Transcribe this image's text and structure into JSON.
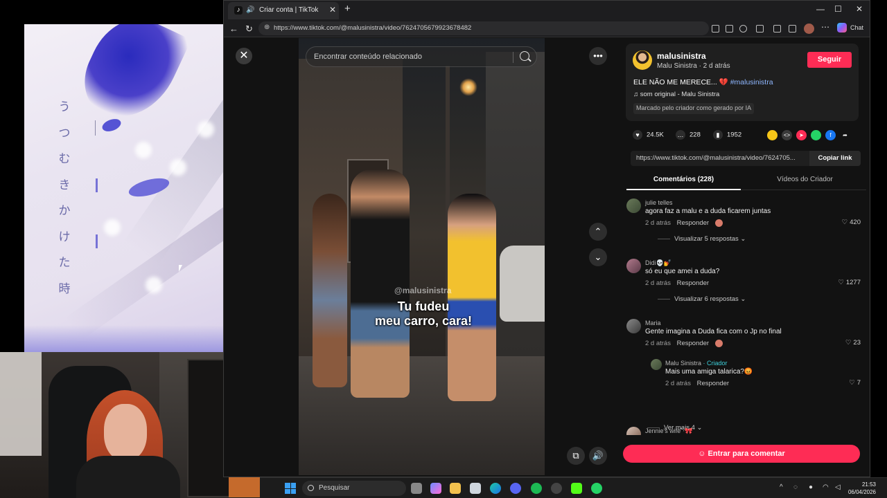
{
  "art": {
    "vertical_text": [
      "う",
      "つ",
      "む",
      "き",
      "か",
      "け",
      "た",
      "時"
    ]
  },
  "browser": {
    "tab_title": "Criar conta | TikTok",
    "url": "https://www.tiktok.com/@malusinistra/video/7624705679923678482",
    "chat_label": "Chat"
  },
  "video": {
    "search_placeholder": "Encontrar conteúdo relacionado",
    "watermark": "@malusinistra",
    "caption_line1": "Tu fudeu",
    "caption_line2": "meu carro, cara!"
  },
  "post": {
    "username": "malusinistra",
    "meta": "Malu Sinistra · 2 d atrás",
    "follow_label": "Seguir",
    "description": "ELE NÃO ME MERECE... 💔",
    "hashtag": "#malusinistra",
    "music": "som original - Malu Sinistra",
    "ai_label": "Marcado pelo criador como gerado por IA",
    "likes": "24.5K",
    "comments": "228",
    "saves": "1952",
    "share_url": "https://www.tiktok.com/@malusinistra/video/7624705...",
    "copy_label": "Copiar link"
  },
  "tabs": {
    "comments": "Comentários (228)",
    "creator_videos": "Vídeos do Criador"
  },
  "comments": [
    {
      "user": "julie telles",
      "text": "agora faz a malu e a duda ficarem juntas",
      "time": "2 d atrás",
      "reply": "Responder",
      "likes": "420",
      "view_replies": "Visualizar 5 respostas ⌄"
    },
    {
      "user": "Didi💀💅",
      "text": "só eu que amei a duda?",
      "time": "2 d atrás",
      "reply": "Responder",
      "likes": "1277",
      "view_replies": "Visualizar 6 respostas ⌄"
    },
    {
      "user": "Maria",
      "text": "Gente imagina a Duda fica com o Jp no final",
      "time": "2 d atrás",
      "reply": "Responder",
      "likes": "23"
    },
    {
      "user": "Malu Sinistra",
      "creator_tag": "· Criador",
      "text": "Mais uma amiga talarica?😡",
      "time": "2 d atrás",
      "reply": "Responder",
      "likes": "7",
      "view_more": "Ver mais 4 ⌄"
    },
    {
      "user": "Jennie's wife˚‧🎀"
    }
  ],
  "enter_comment": "Entrar para comentar",
  "taskbar": {
    "search_placeholder": "Pesquisar",
    "time": "21:53",
    "date": "06/04/2026"
  }
}
